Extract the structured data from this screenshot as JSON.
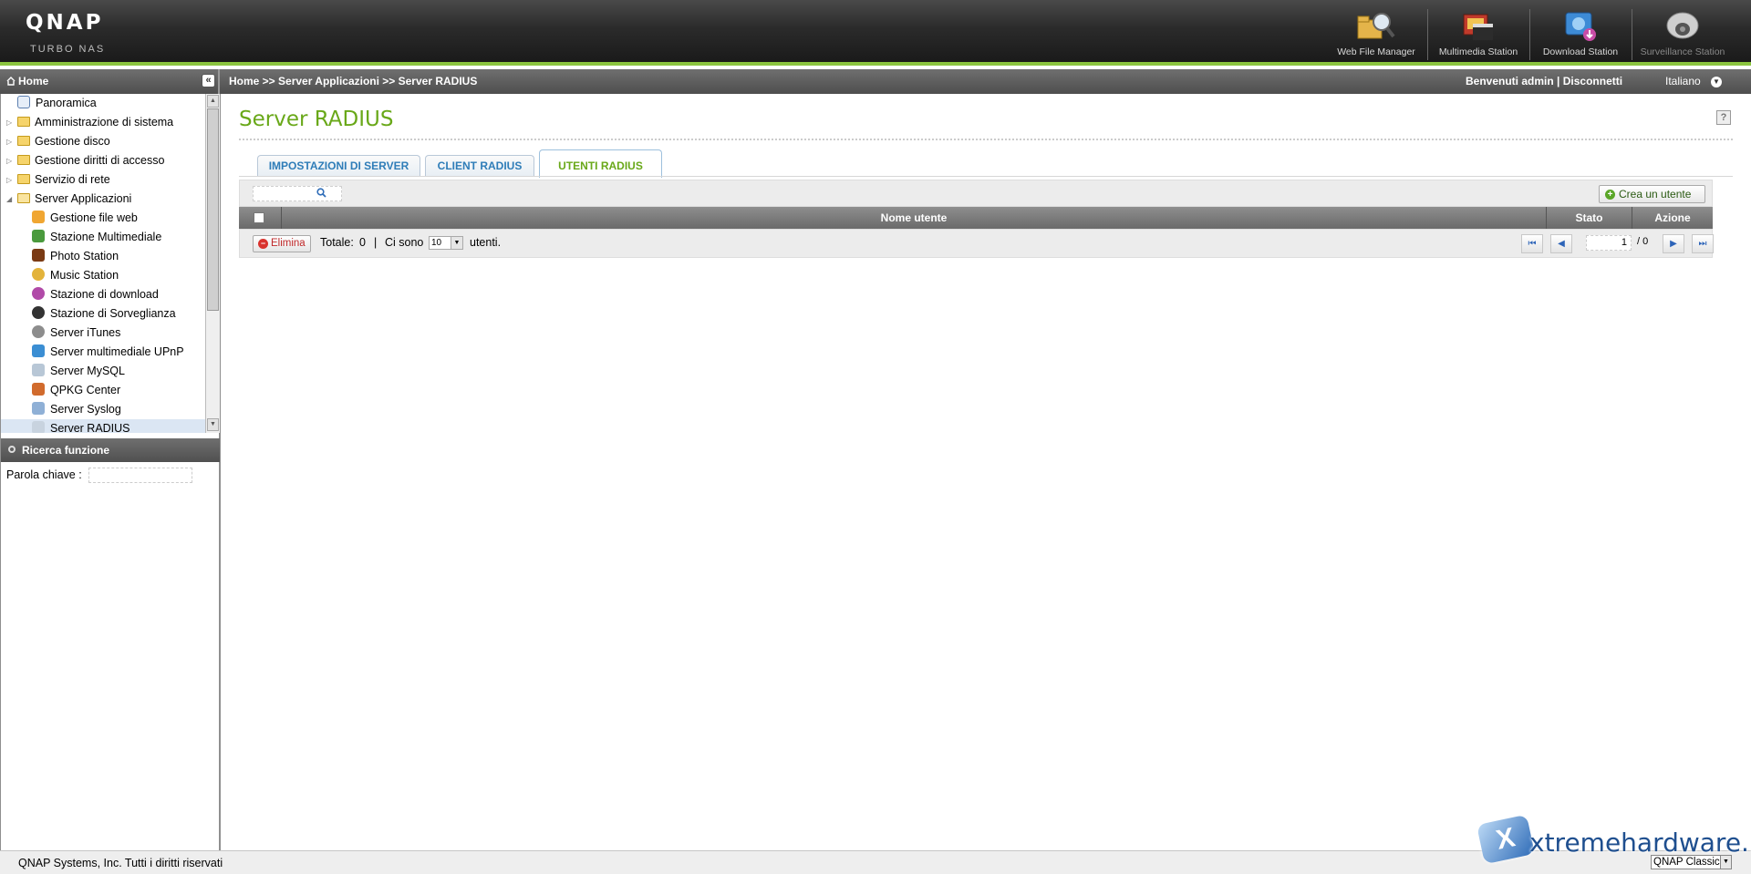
{
  "brand": {
    "name": "QNAP",
    "sub": "TURBO NAS"
  },
  "apps": [
    {
      "label": "Web File Manager",
      "icon": "web-file-manager-icon"
    },
    {
      "label": "Multimedia Station",
      "icon": "multimedia-station-icon"
    },
    {
      "label": "Download Station",
      "icon": "download-station-icon"
    },
    {
      "label": "Surveillance Station",
      "icon": "surveillance-station-icon"
    }
  ],
  "topbar": {
    "home": "Home",
    "breadcrumb": "Home >> Server Applicazioni >> Server RADIUS",
    "welcome": "Benvenuti admin",
    "separator": "|",
    "logout": "Disconnetti",
    "language": "Italiano"
  },
  "tree": {
    "items": [
      {
        "label": "Panoramica"
      },
      {
        "label": "Amministrazione di sistema"
      },
      {
        "label": "Gestione disco"
      },
      {
        "label": "Gestione diritti di accesso"
      },
      {
        "label": "Servizio di rete"
      },
      {
        "label": "Server Applicazioni"
      },
      {
        "label": "Gestione file web"
      },
      {
        "label": "Stazione Multimediale"
      },
      {
        "label": "Photo Station"
      },
      {
        "label": "Music Station"
      },
      {
        "label": "Stazione di download"
      },
      {
        "label": "Stazione di Sorveglianza"
      },
      {
        "label": "Server iTunes"
      },
      {
        "label": "Server multimediale UPnP"
      },
      {
        "label": "Server MySQL"
      },
      {
        "label": "QPKG Center"
      },
      {
        "label": "Server Syslog"
      },
      {
        "label": "Server RADIUS"
      }
    ]
  },
  "func_search": {
    "title": "Ricerca funzione",
    "keyword_label": "Parola chiave :",
    "keyword_value": ""
  },
  "page": {
    "title": "Server RADIUS"
  },
  "tabs": [
    {
      "label": "IMPOSTAZIONI DI SERVER",
      "active": false
    },
    {
      "label": "CLIENT RADIUS",
      "active": false
    },
    {
      "label": "UTENTI RADIUS",
      "active": true
    }
  ],
  "toolbar": {
    "search_value": "",
    "create_label": "Crea un utente"
  },
  "table": {
    "columns": [
      "Nome utente",
      "Stato",
      "Azione"
    ],
    "rows": []
  },
  "footer": {
    "delete_label": "Elimina",
    "total_label": "Totale:",
    "total_value": "0",
    "sep": "|",
    "per_page_label": "Ci sono",
    "per_page_value": "10",
    "per_page_suffix": "utenti.",
    "page_value": "1",
    "page_total": "/ 0"
  },
  "status": {
    "copyright": "QNAP Systems, Inc. Tutti i diritti riservati",
    "theme": "QNAP Classic"
  },
  "watermark": {
    "text": "xtremehardware.it"
  },
  "colors": {
    "accent_green": "#69a819",
    "tab_blue": "#2f7db8",
    "header_dark": "#2b2b2b",
    "accent_bar": "#8bc53f"
  }
}
